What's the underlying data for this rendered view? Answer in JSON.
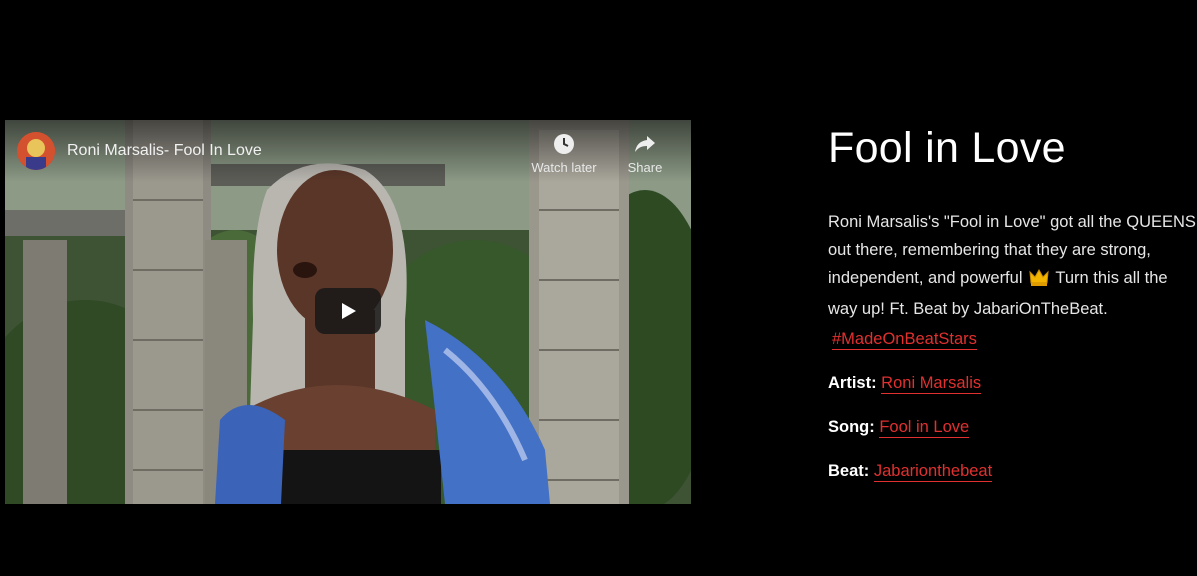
{
  "video": {
    "title": "Roni Marsalis- Fool In Love",
    "watch_later_label": "Watch later",
    "share_label": "Share",
    "icons": [
      "channel-avatar",
      "clock-icon",
      "share-arrow-icon",
      "play-icon"
    ],
    "play_button_color": "#171717"
  },
  "info": {
    "title": "Fool in Love",
    "description": "Roni Marsalis's \"Fool in Love\" got all the QUEENS out there, remembering that they are strong, independent, and powerful",
    "description_after_emoji": "Turn this all the way up! Ft. Beat by JabariOnTheBeat.",
    "emoji": "crown-icon",
    "hashtag": "#MadeOnBeatStars",
    "artist_label": "Artist:",
    "artist_value": "Roni Marsalis",
    "song_label": "Song:",
    "song_value": "Fool in Love",
    "beat_label": "Beat:",
    "beat_value": "Jabarionthebeat"
  },
  "colors": {
    "background": "#000000",
    "link": "#e0302f",
    "text": "#ffffff"
  }
}
